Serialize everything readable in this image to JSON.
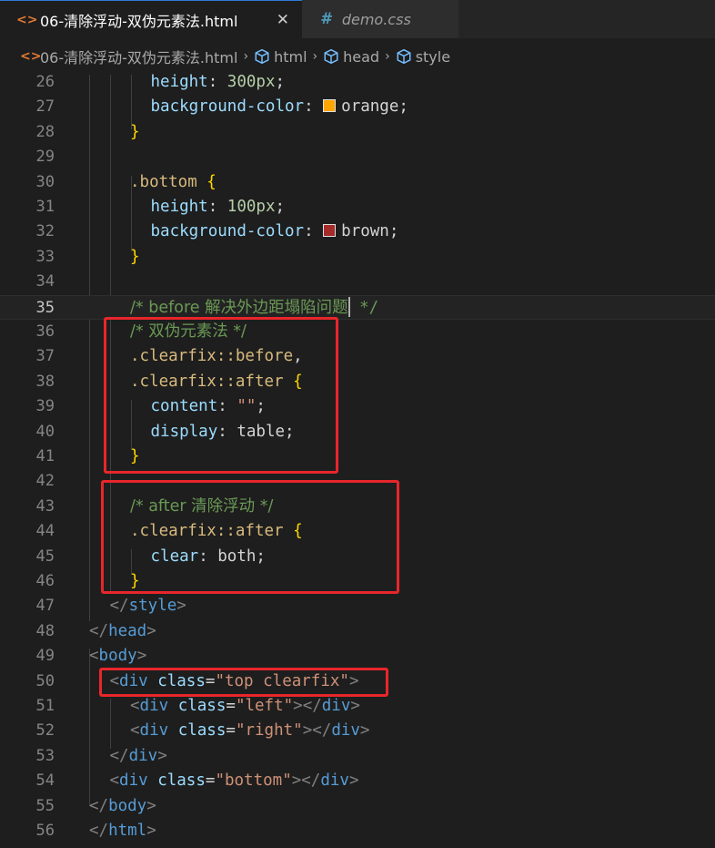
{
  "tabs": [
    {
      "label": "06-清除浮动-双伪元素法.html",
      "icon": "html-code-icon",
      "active": true,
      "close": "✕"
    },
    {
      "label": "demo.css",
      "icon": "css-hash-icon",
      "active": false
    }
  ],
  "breadcrumb": {
    "file": "06-清除浮动-双伪元素法.html",
    "items": [
      "html",
      "head",
      "style"
    ]
  },
  "colors": {
    "orange_swatch": "#ffa500",
    "brown_swatch": "#a52a2a",
    "highlight_box": "#e8262b"
  },
  "active_line": "35",
  "lines": [
    {
      "n": "26",
      "tokens": [
        [
          "prop",
          "height"
        ],
        [
          "punct",
          ": "
        ],
        [
          "num",
          "300px"
        ],
        [
          "punct",
          ";"
        ]
      ]
    },
    {
      "n": "27",
      "tokens": [
        [
          "prop",
          "background-color"
        ],
        [
          "punct",
          ": "
        ],
        [
          "val",
          "orange"
        ],
        [
          "punct",
          ";"
        ]
      ]
    },
    {
      "n": "28",
      "tokens": [
        [
          "brace",
          "}"
        ]
      ]
    },
    {
      "n": "29",
      "tokens": []
    },
    {
      "n": "30",
      "tokens": [
        [
          "sel",
          ".bottom "
        ],
        [
          "brace",
          "{"
        ]
      ]
    },
    {
      "n": "31",
      "tokens": [
        [
          "prop",
          "height"
        ],
        [
          "punct",
          ": "
        ],
        [
          "num",
          "100px"
        ],
        [
          "punct",
          ";"
        ]
      ]
    },
    {
      "n": "32",
      "tokens": [
        [
          "prop",
          "background-color"
        ],
        [
          "punct",
          ": "
        ],
        [
          "val",
          "brown"
        ],
        [
          "punct",
          ";"
        ]
      ]
    },
    {
      "n": "33",
      "tokens": [
        [
          "brace",
          "}"
        ]
      ]
    },
    {
      "n": "34",
      "tokens": []
    },
    {
      "n": "35",
      "tokens": [
        [
          "comment",
          "/* before 解决外边距塌陷问题"
        ],
        [
          "comment",
          " */"
        ]
      ]
    },
    {
      "n": "36",
      "tokens": [
        [
          "comment",
          "/* 双伪元素法 */"
        ]
      ]
    },
    {
      "n": "37",
      "tokens": [
        [
          "sel",
          ".clearfix::before"
        ],
        [
          "punct",
          ","
        ]
      ]
    },
    {
      "n": "38",
      "tokens": [
        [
          "sel",
          ".clearfix::after "
        ],
        [
          "brace",
          "{"
        ]
      ]
    },
    {
      "n": "39",
      "tokens": [
        [
          "prop",
          "content"
        ],
        [
          "punct",
          ": "
        ],
        [
          "str",
          "\"\""
        ],
        [
          "punct",
          ";"
        ]
      ]
    },
    {
      "n": "40",
      "tokens": [
        [
          "prop",
          "display"
        ],
        [
          "punct",
          ": "
        ],
        [
          "val",
          "table"
        ],
        [
          "punct",
          ";"
        ]
      ]
    },
    {
      "n": "41",
      "tokens": [
        [
          "brace",
          "}"
        ]
      ]
    },
    {
      "n": "42",
      "tokens": []
    },
    {
      "n": "43",
      "tokens": [
        [
          "comment",
          "/* after 清除浮动 */"
        ]
      ]
    },
    {
      "n": "44",
      "tokens": [
        [
          "sel",
          ".clearfix::after "
        ],
        [
          "brace",
          "{"
        ]
      ]
    },
    {
      "n": "45",
      "tokens": [
        [
          "prop",
          "clear"
        ],
        [
          "punct",
          ": "
        ],
        [
          "val",
          "both"
        ],
        [
          "punct",
          ";"
        ]
      ]
    },
    {
      "n": "46",
      "tokens": [
        [
          "brace",
          "}"
        ]
      ]
    },
    {
      "n": "47",
      "tokens": [
        [
          "bracket",
          "</"
        ],
        [
          "tag",
          "style"
        ],
        [
          "bracket",
          ">"
        ]
      ]
    },
    {
      "n": "48",
      "tokens": [
        [
          "bracket",
          "</"
        ],
        [
          "tag",
          "head"
        ],
        [
          "bracket",
          ">"
        ]
      ]
    },
    {
      "n": "49",
      "tokens": [
        [
          "bracket",
          "<"
        ],
        [
          "tag",
          "body"
        ],
        [
          "bracket",
          ">"
        ]
      ]
    },
    {
      "n": "50",
      "tokens": [
        [
          "bracket",
          "<"
        ],
        [
          "tag",
          "div "
        ],
        [
          "attr",
          "class"
        ],
        [
          "punct",
          "="
        ],
        [
          "str",
          "\"top clearfix\""
        ],
        [
          "bracket",
          ">"
        ]
      ]
    },
    {
      "n": "51",
      "tokens": [
        [
          "bracket",
          "<"
        ],
        [
          "tag",
          "div "
        ],
        [
          "attr",
          "class"
        ],
        [
          "punct",
          "="
        ],
        [
          "str",
          "\"left\""
        ],
        [
          "bracket",
          "></"
        ],
        [
          "tag",
          "div"
        ],
        [
          "bracket",
          ">"
        ]
      ]
    },
    {
      "n": "52",
      "tokens": [
        [
          "bracket",
          "<"
        ],
        [
          "tag",
          "div "
        ],
        [
          "attr",
          "class"
        ],
        [
          "punct",
          "="
        ],
        [
          "str",
          "\"right\""
        ],
        [
          "bracket",
          "></"
        ],
        [
          "tag",
          "div"
        ],
        [
          "bracket",
          ">"
        ]
      ]
    },
    {
      "n": "53",
      "tokens": [
        [
          "bracket",
          "</"
        ],
        [
          "tag",
          "div"
        ],
        [
          "bracket",
          ">"
        ]
      ]
    },
    {
      "n": "54",
      "tokens": [
        [
          "bracket",
          "<"
        ],
        [
          "tag",
          "div "
        ],
        [
          "attr",
          "class"
        ],
        [
          "punct",
          "="
        ],
        [
          "str",
          "\"bottom\""
        ],
        [
          "bracket",
          "></"
        ],
        [
          "tag",
          "div"
        ],
        [
          "bracket",
          ">"
        ]
      ]
    },
    {
      "n": "55",
      "tokens": [
        [
          "bracket",
          "</"
        ],
        [
          "tag",
          "body"
        ],
        [
          "bracket",
          ">"
        ]
      ]
    },
    {
      "n": "56",
      "tokens": [
        [
          "bracket",
          "</"
        ],
        [
          "tag",
          "html"
        ],
        [
          "bracket",
          ">"
        ]
      ]
    }
  ]
}
